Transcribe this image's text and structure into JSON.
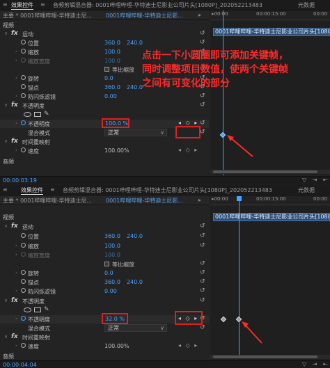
{
  "tabs": {
    "effect_controls": "效果控件",
    "menu_icon": "≡",
    "audio_mixer": "音频剪辑混合器: 0001哔哩哔哩-华特迪士尼影业公司片头[1080P]_202052213483",
    "metadata": "元数据"
  },
  "clip_header": {
    "master": "主要 * 0001哔哩哔哩-华特迪士尼...",
    "sequence": "0001哔哩哔哩-华特迪士尼影...",
    "arrow": "▸"
  },
  "timeline": {
    "ruler_start": "▸00:00",
    "ruler_mid": "00:00:15:00",
    "ruler_end": "00:00",
    "clip_label": "0001哔哩哔哩-华特迪士尼影业公司片头[1080P]_20"
  },
  "section_video": "视频",
  "section_audio": "音频",
  "fx_symbol": "fx",
  "twirl_open": "∨",
  "twirl_closed": "›",
  "reset_symbol": "↺",
  "dropdown_caret": "∨",
  "pen_symbol": "✎",
  "effects": {
    "motion": "运动",
    "position": "位置",
    "position_x": "360.0",
    "position_y": "240.0",
    "scale": "缩放",
    "scale_val": "100.0",
    "scale_width": "缩放宽度",
    "scale_width_val": "100.0",
    "uniform_scale": "等比缩放",
    "rotation": "旋转",
    "rotation_val": "0.0",
    "anchor": "锚点",
    "anchor_x": "360.0",
    "anchor_y": "240.0",
    "anti_flicker": "防闪烁滤镜",
    "anti_flicker_val": "0.00",
    "opacity": "不透明度",
    "opacity_prop": "不透明度",
    "blend_mode": "混合模式",
    "blend_val": "正常",
    "time_remap": "时间重映射",
    "speed": "速度",
    "speed_val": "100.00%"
  },
  "panel1": {
    "opacity_val": "100.0 %",
    "timecode": "00:00:03:19"
  },
  "panel2": {
    "opacity_val": "32.0 %",
    "timecode": "00:00:04:04"
  },
  "kf_nav": "◂ ◇ ▸",
  "kf_nav_small": "◂ ◇ ▸",
  "bottom_icons": "▽ ⇥ ⇤",
  "annotation": {
    "line1": "点击一下小圆圈即可添加关键帧，",
    "line2": "同时调整项目数值，使两个关键帧",
    "line3": "之间有可变化的部分"
  }
}
